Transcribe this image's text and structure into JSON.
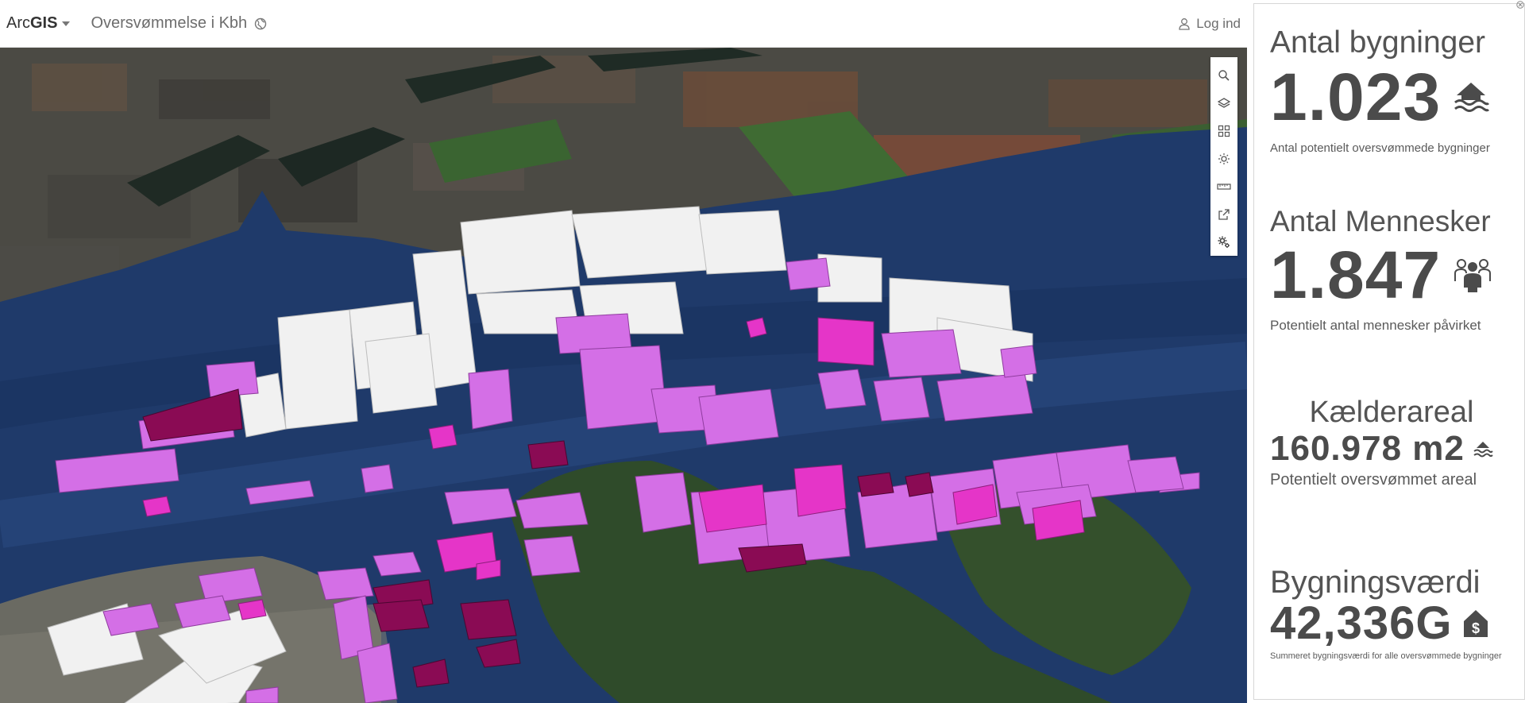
{
  "header": {
    "brand_regular": "Arc",
    "brand_bold": "GIS",
    "scene_title": "Oversvømmelse i Kbh",
    "login_label": "Log ind"
  },
  "map_tools": [
    {
      "icon": "search-icon"
    },
    {
      "icon": "layers-icon"
    },
    {
      "icon": "basemap-gallery-icon"
    },
    {
      "icon": "daylight-icon"
    },
    {
      "icon": "measure-icon"
    },
    {
      "icon": "share-icon"
    },
    {
      "icon": "settings-icon"
    }
  ],
  "indicators": [
    {
      "title": "Antal bygninger",
      "value": "1.023",
      "caption": "Antal potentielt oversvømmede bygninger",
      "icon": "flooded-house-icon"
    },
    {
      "title": "Antal Mennesker",
      "value": "1.847",
      "caption": "Potentielt antal mennesker påvirket",
      "icon": "people-icon"
    },
    {
      "title": "Kælderareal",
      "value": "160.978 m2",
      "caption": "Potentielt oversvømmet areal",
      "icon": "flood-waves-icon"
    },
    {
      "title": "Bygningsværdi",
      "value": "42,336G",
      "caption": "Summeret bygningsværdi for alle oversvømmede bygninger",
      "icon": "building-value-icon"
    }
  ],
  "colors": {
    "water": "#1f3a6a",
    "flooded_building": "#d46fe6",
    "flooded_building_strong": "#e535c8",
    "flooded_building_dark": "#8a0b54",
    "building": "#f2f2f2",
    "text": "#4b4b4b"
  }
}
